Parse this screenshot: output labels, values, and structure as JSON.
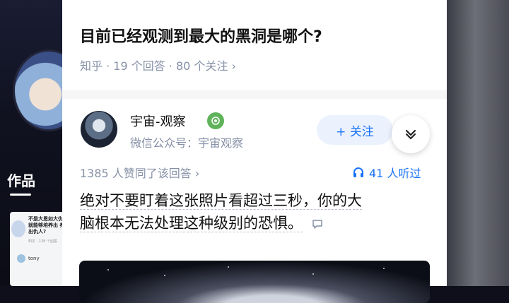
{
  "sidebar": {
    "works_label": "作品",
    "thumb": {
      "title": "不是大恩如大仇 就能够培养出 养出仇人?",
      "meta": "知乎 · 138 个回答",
      "user": "tony"
    }
  },
  "question": {
    "title": "目前已经观测到最大的黑洞是哪个?",
    "meta": "知乎 · 19 个回答 · 80 个关注 ›"
  },
  "author": {
    "name": "宇宙-观察",
    "subtitle": "微信公众号：宇宙观察",
    "follow_label": "+ 关注"
  },
  "stats": {
    "likes": "1385 人赞同了该回答 ›",
    "listeners": "41 人听过"
  },
  "answer": {
    "line1": "绝对不要盯着这张照片看超过三秒，你的大",
    "line2": "脑根本无法处理这种级别的恐惧。"
  },
  "colors": {
    "accent": "#1772f6",
    "meta_gray": "#8590a6",
    "badge_green": "#5fb35a"
  },
  "icons": [
    "expand-chevron-icon",
    "headphones-icon",
    "comment-icon",
    "verified-badge-icon"
  ]
}
